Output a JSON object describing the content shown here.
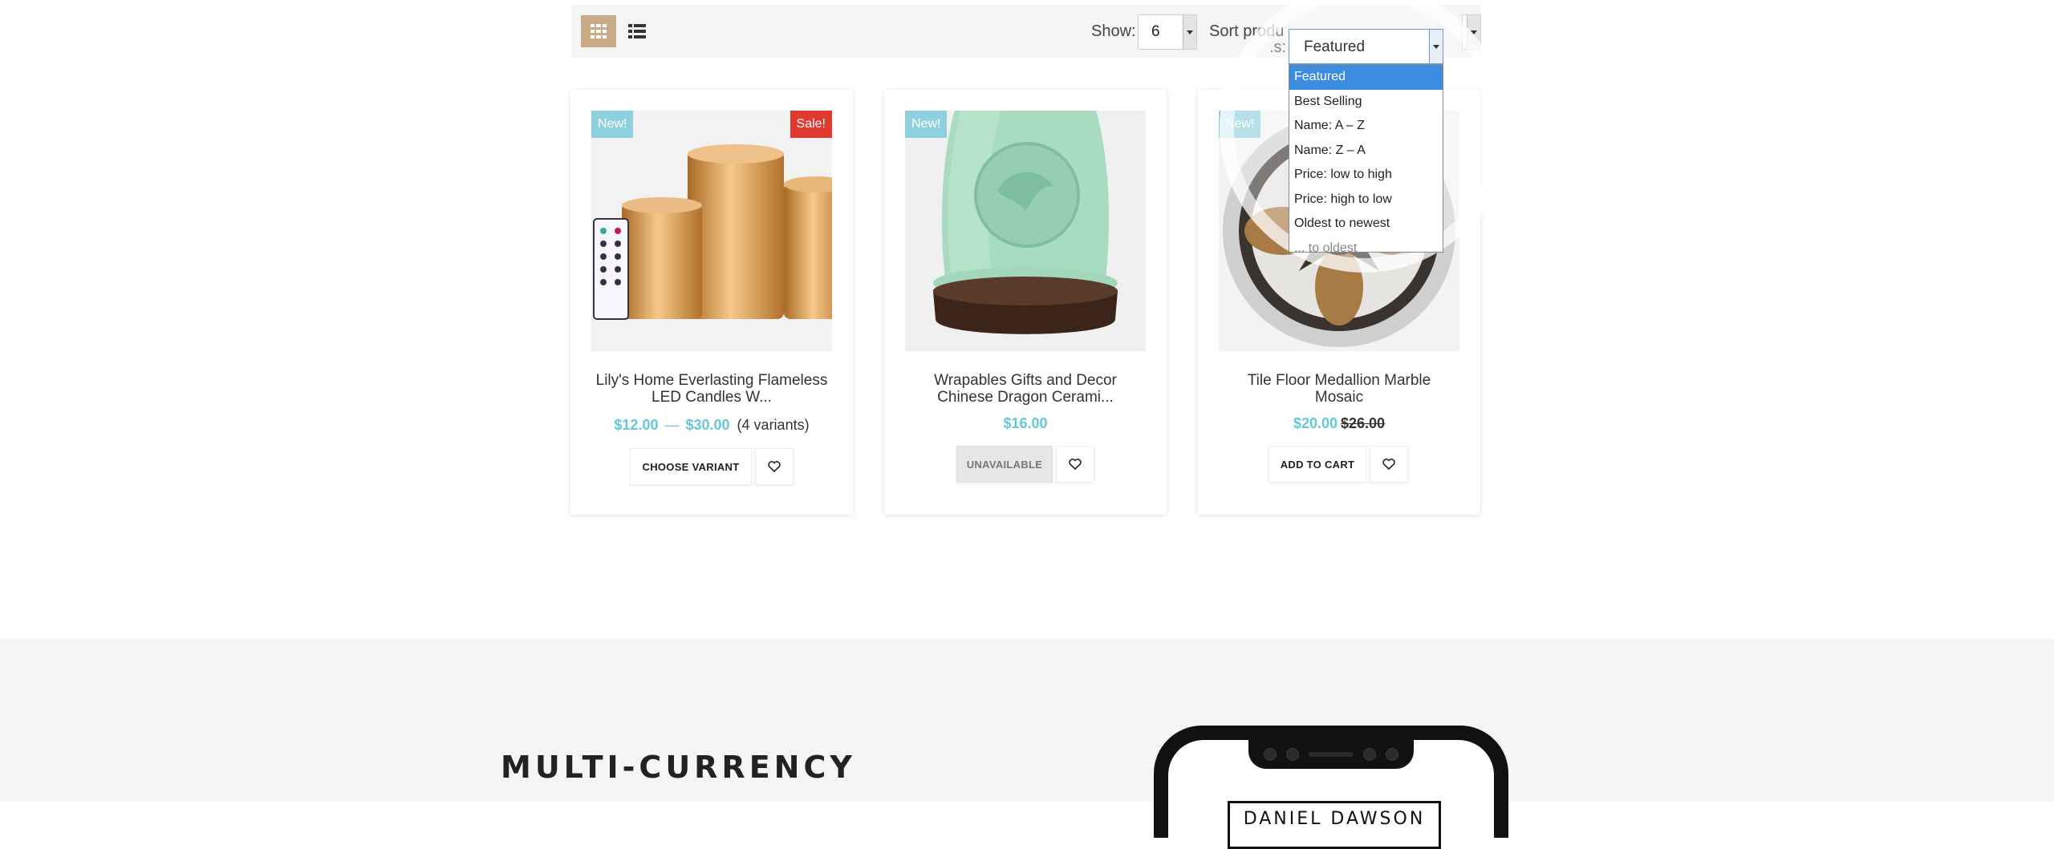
{
  "toolbar": {
    "grid_view_icon": "grid-icon",
    "list_view_icon": "list-icon",
    "show_label": "Show:",
    "show_value": "6",
    "sort_label": "Sort produ",
    "sort_label_tail": ".s:",
    "sort_value": "Featured"
  },
  "sort_dropdown": {
    "options": [
      "Featured",
      "Best Selling",
      "Name: A – Z",
      "Name: Z – A",
      "Price: low to high",
      "Price: high to low",
      "Oldest to newest",
      "... to oldest"
    ],
    "selected_index": 0
  },
  "products": [
    {
      "title_line1": "Lily's Home Everlasting Flameless",
      "title_line2": "LED Candles W...",
      "badge_new": "New!",
      "badge_sale": "Sale!",
      "price_min": "$12.00",
      "price_sep": "—",
      "price_max": "$30.00",
      "variants": "(4 variants)",
      "button": "CHOOSE VARIANT"
    },
    {
      "title_line1": "Wrapables Gifts and Decor",
      "title_line2": "Chinese Dragon Cerami...",
      "badge_new": "New!",
      "price": "$16.00",
      "button": "UNAVAILABLE"
    },
    {
      "title_line1": "Tile Floor Medallion Marble",
      "title_line2": "Mosaic",
      "badge_new": "New!",
      "price": "$20.00",
      "compare_price": "$26.00",
      "button": "ADD TO CART"
    }
  ],
  "promo": {
    "title": "MULTI-CURRENCY",
    "phone_name": "DANIEL DAWSON"
  },
  "colors": {
    "accent_tan": "#c9ac87",
    "price_blue": "#66c7da",
    "new_badge": "#8fd0de",
    "sale_badge": "#e0392f",
    "dropdown_selected": "#3c8de0"
  }
}
